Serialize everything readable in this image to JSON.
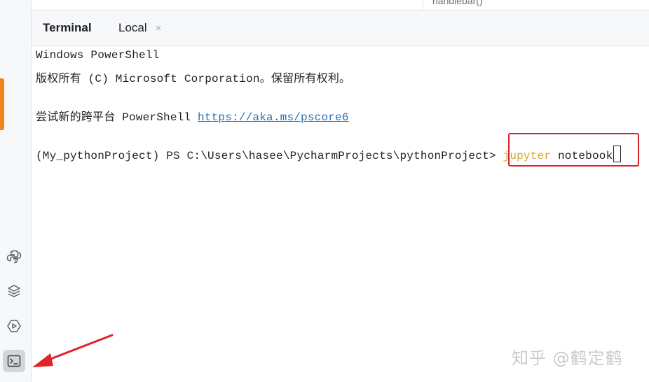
{
  "editor": {
    "snippet": "handlebar()"
  },
  "panel": {
    "title": "Terminal",
    "tabs": [
      {
        "label": "Local",
        "close_glyph": "×"
      }
    ]
  },
  "terminal": {
    "lines": [
      "Windows PowerShell",
      "版权所有 (C) Microsoft Corporation。保留所有权利。",
      "",
      "尝试新的跨平台 PowerShell",
      "",
      "(My_pythonProject) PS C:\\Users\\hasee\\PycharmProjects\\pythonProject>"
    ],
    "link": "https://aka.ms/pscore6",
    "command_keyword": "jupyter",
    "command_arg": "notebook"
  },
  "sidebar": {
    "icons": [
      "python-console-icon",
      "layers-icon",
      "services-icon",
      "terminal-icon"
    ],
    "accent_color": "#f6821f"
  },
  "annotation": {
    "box_color": "#d6232a",
    "arrow_color": "#e0242b"
  },
  "watermark": "知乎 @鹤定鹤",
  "colors": {
    "link": "#2a6ebb",
    "keyword": "#d4a72c",
    "text": "#1f2023"
  }
}
